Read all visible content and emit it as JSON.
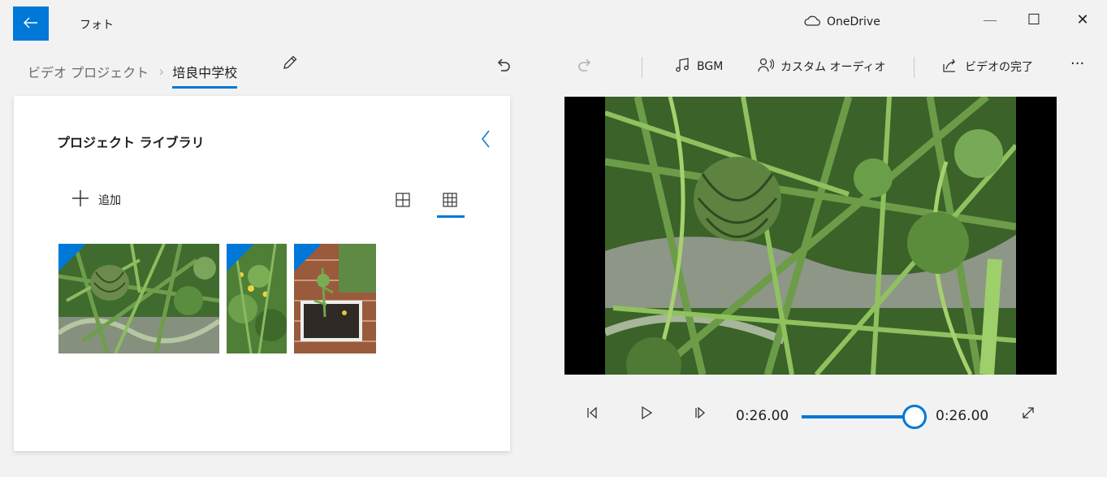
{
  "window": {
    "app_title": "フォト",
    "onedrive_label": "OneDrive",
    "back_icon": "arrow-left-icon",
    "minimize_glyph": "—",
    "maximize_glyph": "☐",
    "close_glyph": "✕"
  },
  "toolbar": {
    "breadcrumb_root": "ビデオ プロジェクト",
    "breadcrumb_current": "培良中学校",
    "bgm_label": "BGM",
    "custom_audio_label": "カスタム オーディオ",
    "finish_label": "ビデオの完了",
    "more_glyph": "···"
  },
  "library": {
    "title": "プロジェクト ライブラリ",
    "add_label": "追加",
    "items": [
      {
        "name": "watermelon-in-grass"
      },
      {
        "name": "yellow-flowers-plant"
      },
      {
        "name": "garden-bed-planter"
      }
    ]
  },
  "player": {
    "current_time": "0:26.00",
    "total_time": "0:26.00",
    "progress": 1.0
  },
  "colors": {
    "accent": "#0078d7",
    "background": "#f2f2f2",
    "panel": "#ffffff"
  }
}
